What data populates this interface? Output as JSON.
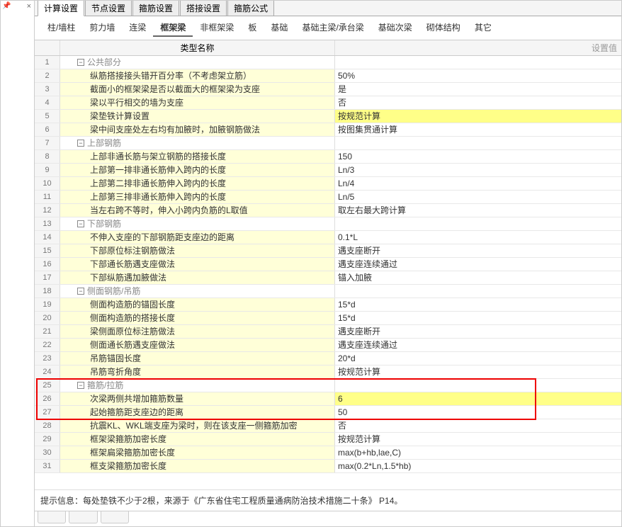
{
  "tabs": [
    "计算设置",
    "节点设置",
    "箍筋设置",
    "搭接设置",
    "箍筋公式"
  ],
  "active_tab": 0,
  "subtabs": [
    "柱/墙柱",
    "剪力墙",
    "连梁",
    "框架梁",
    "非框架梁",
    "板",
    "基础",
    "基础主梁/承台梁",
    "基础次梁",
    "砌体结构",
    "其它"
  ],
  "active_subtab": 3,
  "grid_headers": {
    "name": "类型名称",
    "value": "设置值"
  },
  "rows": [
    {
      "n": 1,
      "group": true,
      "label": "公共部分",
      "val": ""
    },
    {
      "n": 2,
      "label": "纵筋搭接接头错开百分率（不考虑架立筋）",
      "val": "50%"
    },
    {
      "n": 3,
      "label": "截面小的框架梁是否以截面大的框架梁为支座",
      "val": "是"
    },
    {
      "n": 4,
      "label": "梁以平行相交的墙为支座",
      "val": "否"
    },
    {
      "n": 5,
      "label": "梁垫铁计算设置",
      "val": "按规范计算",
      "sel": true
    },
    {
      "n": 6,
      "label": "梁中间支座处左右均有加腋时，加腋钢筋做法",
      "val": "按图集贯通计算"
    },
    {
      "n": 7,
      "group": true,
      "label": "上部钢筋",
      "val": ""
    },
    {
      "n": 8,
      "label": "上部非通长筋与架立钢筋的搭接长度",
      "val": "150"
    },
    {
      "n": 9,
      "label": "上部第一排非通长筋伸入跨内的长度",
      "val": "Ln/3"
    },
    {
      "n": 10,
      "label": "上部第二排非通长筋伸入跨内的长度",
      "val": "Ln/4"
    },
    {
      "n": 11,
      "label": "上部第三排非通长筋伸入跨内的长度",
      "val": "Ln/5"
    },
    {
      "n": 12,
      "label": "当左右跨不等时，伸入小跨内负筋的L取值",
      "val": "取左右最大跨计算"
    },
    {
      "n": 13,
      "group": true,
      "label": "下部钢筋",
      "val": ""
    },
    {
      "n": 14,
      "label": "不伸入支座的下部钢筋距支座边的距离",
      "val": "0.1*L"
    },
    {
      "n": 15,
      "label": "下部原位标注钢筋做法",
      "val": "遇支座断开"
    },
    {
      "n": 16,
      "label": "下部通长筋遇支座做法",
      "val": "遇支座连续通过"
    },
    {
      "n": 17,
      "label": "下部纵筋遇加腋做法",
      "val": "锚入加腋"
    },
    {
      "n": 18,
      "group": true,
      "label": "侧面钢筋/吊筋",
      "val": ""
    },
    {
      "n": 19,
      "label": "侧面构造筋的锚固长度",
      "val": "15*d"
    },
    {
      "n": 20,
      "label": "侧面构造筋的搭接长度",
      "val": "15*d"
    },
    {
      "n": 21,
      "label": "梁侧面原位标注筋做法",
      "val": "遇支座断开"
    },
    {
      "n": 22,
      "label": "侧面通长筋遇支座做法",
      "val": "遇支座连续通过"
    },
    {
      "n": 23,
      "label": "吊筋锚固长度",
      "val": "20*d"
    },
    {
      "n": 24,
      "label": "吊筋弯折角度",
      "val": "按规范计算"
    },
    {
      "n": 25,
      "group": true,
      "label": "箍筋/拉筋",
      "val": ""
    },
    {
      "n": 26,
      "label": "次梁两侧共增加箍筋数量",
      "val": "6",
      "sel": true
    },
    {
      "n": 27,
      "label": "起始箍筋距支座边的距离",
      "val": "50"
    },
    {
      "n": 28,
      "label": "抗震KL、WKL端支座为梁时，则在该支座一侧箍筋加密",
      "val": "否"
    },
    {
      "n": 29,
      "label": "框架梁箍筋加密长度",
      "val": "按规范计算"
    },
    {
      "n": 30,
      "label": "框架扁梁箍筋加密长度",
      "val": "max(b+hb,lae,C)"
    },
    {
      "n": 31,
      "label": "框支梁箍筋加密长度",
      "val": "max(0.2*Ln,1.5*hb)"
    }
  ],
  "footer": "提示信息：每处垫铁不少于2根，来源于《广东省住宅工程质量通病防治技术措施二十条》 P14。",
  "redbox": {
    "top_row": 25,
    "bottom_row": 27
  },
  "bottom_tabs_blank_count": 3,
  "icons": {
    "pin": "📌",
    "close": "×",
    "minus": "−"
  }
}
